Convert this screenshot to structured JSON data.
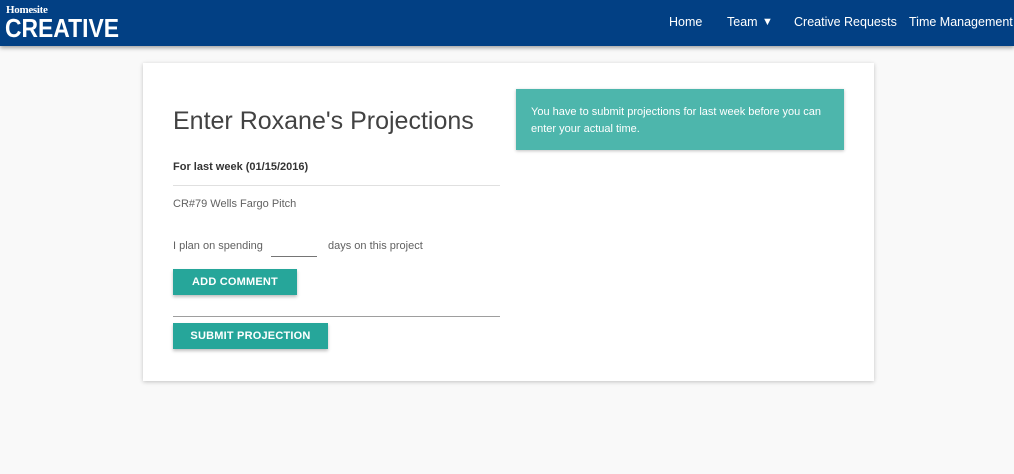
{
  "brand": {
    "top": "Homesite",
    "word": "CREATIVE"
  },
  "nav": {
    "home": "Home",
    "team": "Team",
    "team_caret": "▼",
    "creative_requests": "Creative Requests",
    "time_management": "Time Management"
  },
  "colors": {
    "navbar": "#024084",
    "primary_button": "#26a69a",
    "alert": "#4db6ac"
  },
  "form": {
    "title": "Enter Roxane's Projections",
    "week_label": "For last week (01/15/2016)",
    "project": "CR#79 Wells Fargo Pitch",
    "plan_prefix": "I plan on spending",
    "days_value": "",
    "plan_suffix": "days on this project",
    "add_comment": "ADD COMMENT",
    "submit": "SUBMIT PROJECTION"
  },
  "alert": {
    "message": "You have to submit projections for last week before you can enter your actual time."
  }
}
